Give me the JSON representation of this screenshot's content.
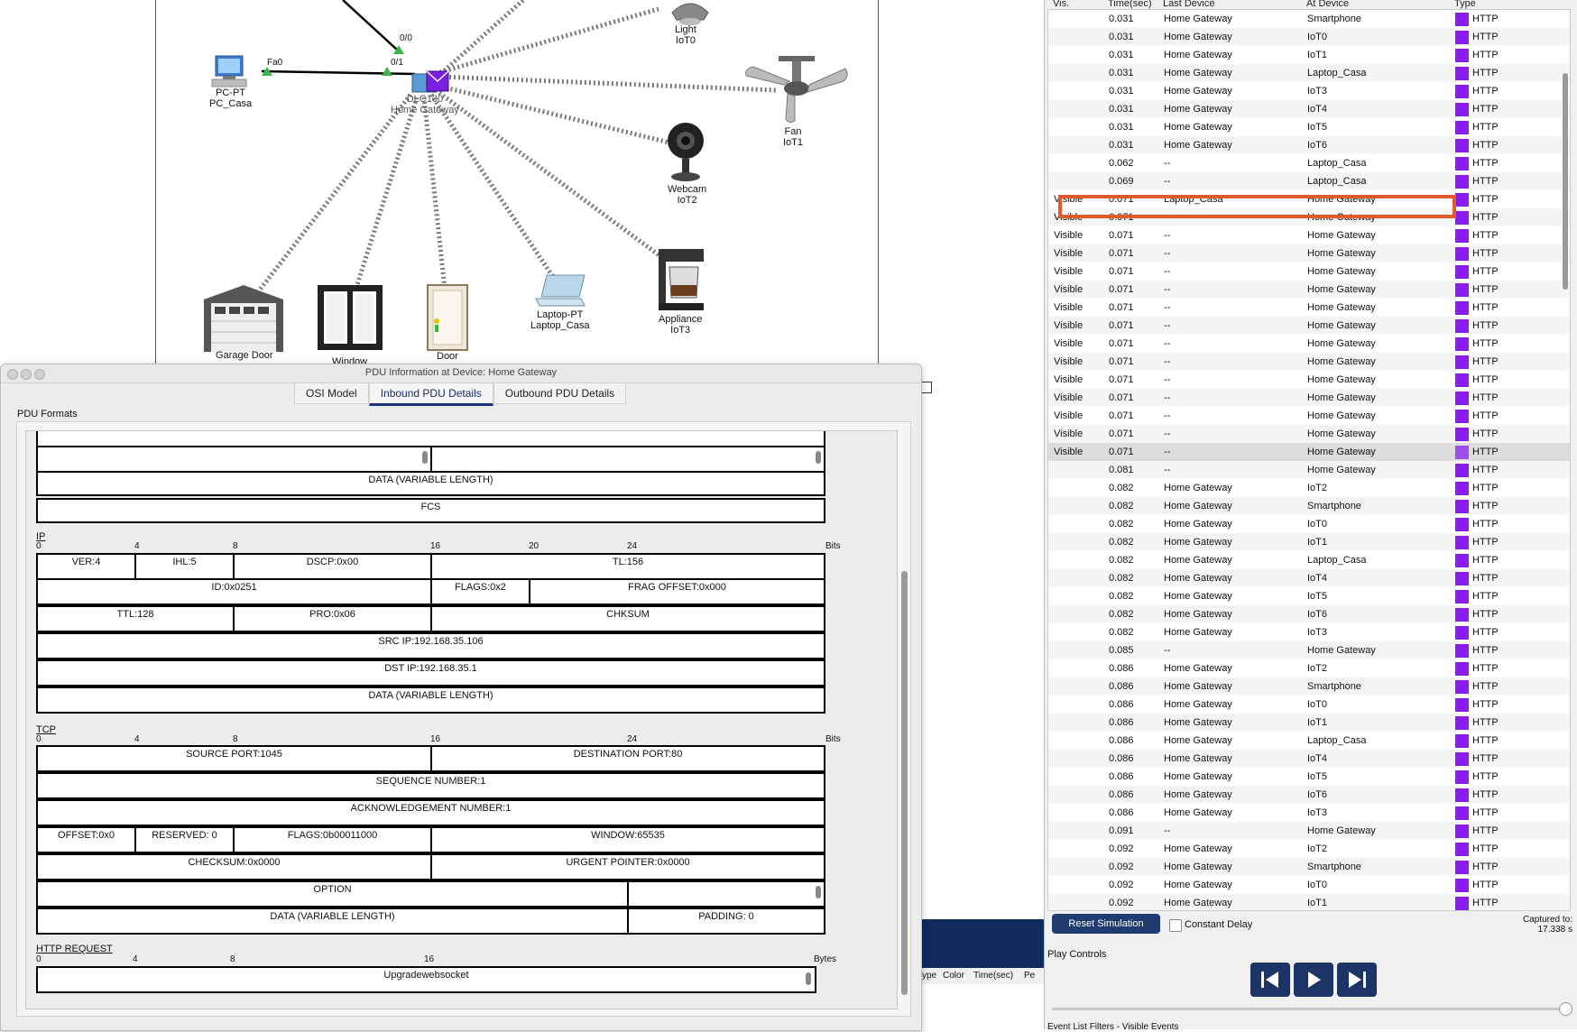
{
  "canvas": {
    "devices": {
      "pc": {
        "type": "PC-PT",
        "name": "PC_Casa"
      },
      "gateway": {
        "type": "DLC100",
        "name": "Home Gateway"
      },
      "light": {
        "type": "Light",
        "name": "IoT0"
      },
      "fan": {
        "type": "Fan",
        "name": "IoT1"
      },
      "webcam": {
        "type": "Webcam",
        "name": "IoT2"
      },
      "appliance": {
        "type": "Appliance",
        "name": "IoT3"
      },
      "laptop": {
        "type": "Laptop-PT",
        "name": "Laptop_Casa"
      },
      "door": {
        "name": "Door"
      },
      "window": {
        "name": "Window"
      },
      "garage": {
        "name": "Garage Door"
      }
    },
    "ports": {
      "fa0": "Fa0",
      "p00": "0/0",
      "p01": "0/1"
    }
  },
  "pdu_window": {
    "title": "PDU Information at Device: Home Gateway",
    "tabs": [
      "OSI Model",
      "Inbound PDU Details",
      "Outbound PDU Details"
    ],
    "active_tab": "Inbound PDU Details",
    "formats_label": "PDU Formats",
    "ethernet": {
      "data": "DATA (VARIABLE LENGTH)",
      "fcs": "FCS"
    },
    "ip": {
      "title": "IP",
      "ticks": [
        "0",
        "4",
        "8",
        "16",
        "20",
        "24",
        "Bits"
      ],
      "ver": "VER:4",
      "ihl": "IHL:5",
      "dscp": "DSCP:0x00",
      "tl": "TL:156",
      "id": "ID:0x0251",
      "flags": "FLAGS:0x2",
      "frag": "FRAG OFFSET:0x000",
      "ttl": "TTL:128",
      "pro": "PRO:0x06",
      "chksum": "CHKSUM",
      "src": "SRC IP:192.168.35.106",
      "dst": "DST IP:192.168.35.1",
      "data": "DATA (VARIABLE LENGTH)"
    },
    "tcp": {
      "title": "TCP",
      "ticks": [
        "0",
        "4",
        "8",
        "16",
        "24",
        "Bits"
      ],
      "src_port": "SOURCE PORT:1045",
      "dst_port": "DESTINATION PORT:80",
      "seq": "SEQUENCE NUMBER:1",
      "ack": "ACKNOWLEDGEMENT NUMBER:1",
      "offset": "OFFSET:0x0",
      "reserved": "RESERVED: 0",
      "flags": "FLAGS:0b00011000",
      "window": "WINDOW:65535",
      "checksum": "CHECKSUM:0x0000",
      "urgent": "URGENT POINTER:0x0000",
      "option": "OPTION",
      "data": "DATA (VARIABLE LENGTH)",
      "padding": "PADDING: 0"
    },
    "http": {
      "title": "HTTP REQUEST",
      "ticks": [
        "0",
        "4",
        "8",
        "16",
        "Bytes"
      ],
      "content": "Upgradewebsocket"
    }
  },
  "event_list": {
    "headers": [
      "Vis.",
      "Time(sec)",
      "Last Device",
      "At Device",
      "Type"
    ],
    "type_color": "#8a1cf0",
    "highlight_color": "#e05a2b",
    "rows": [
      [
        "",
        "0.031",
        "Home Gateway",
        "Smartphone",
        "HTTP"
      ],
      [
        "",
        "0.031",
        "Home Gateway",
        "IoT0",
        "HTTP"
      ],
      [
        "",
        "0.031",
        "Home Gateway",
        "IoT1",
        "HTTP"
      ],
      [
        "",
        "0.031",
        "Home Gateway",
        "Laptop_Casa",
        "HTTP"
      ],
      [
        "",
        "0.031",
        "Home Gateway",
        "IoT3",
        "HTTP"
      ],
      [
        "",
        "0.031",
        "Home Gateway",
        "IoT4",
        "HTTP"
      ],
      [
        "",
        "0.031",
        "Home Gateway",
        "IoT5",
        "HTTP"
      ],
      [
        "",
        "0.031",
        "Home Gateway",
        "IoT6",
        "HTTP"
      ],
      [
        "",
        "0.062",
        "--",
        "Laptop_Casa",
        "HTTP"
      ],
      [
        "",
        "0.069",
        "--",
        "Laptop_Casa",
        "HTTP"
      ],
      [
        "Visible",
        "0.071",
        "Laptop_Casa",
        "Home Gateway",
        "HTTP"
      ],
      [
        "Visible",
        "0.071",
        "--",
        "Home Gateway",
        "HTTP"
      ],
      [
        "Visible",
        "0.071",
        "--",
        "Home Gateway",
        "HTTP"
      ],
      [
        "Visible",
        "0.071",
        "--",
        "Home Gateway",
        "HTTP"
      ],
      [
        "Visible",
        "0.071",
        "--",
        "Home Gateway",
        "HTTP"
      ],
      [
        "Visible",
        "0.071",
        "--",
        "Home Gateway",
        "HTTP"
      ],
      [
        "Visible",
        "0.071",
        "--",
        "Home Gateway",
        "HTTP"
      ],
      [
        "Visible",
        "0.071",
        "--",
        "Home Gateway",
        "HTTP"
      ],
      [
        "Visible",
        "0.071",
        "--",
        "Home Gateway",
        "HTTP"
      ],
      [
        "Visible",
        "0.071",
        "--",
        "Home Gateway",
        "HTTP"
      ],
      [
        "Visible",
        "0.071",
        "--",
        "Home Gateway",
        "HTTP"
      ],
      [
        "Visible",
        "0.071",
        "--",
        "Home Gateway",
        "HTTP"
      ],
      [
        "Visible",
        "0.071",
        "--",
        "Home Gateway",
        "HTTP"
      ],
      [
        "Visible",
        "0.071",
        "--",
        "Home Gateway",
        "HTTP"
      ],
      [
        "Visible",
        "0.071",
        "--",
        "Home Gateway",
        "HTTP"
      ],
      [
        "",
        "0.081",
        "--",
        "Home Gateway",
        "HTTP"
      ],
      [
        "",
        "0.082",
        "Home Gateway",
        "IoT2",
        "HTTP"
      ],
      [
        "",
        "0.082",
        "Home Gateway",
        "Smartphone",
        "HTTP"
      ],
      [
        "",
        "0.082",
        "Home Gateway",
        "IoT0",
        "HTTP"
      ],
      [
        "",
        "0.082",
        "Home Gateway",
        "IoT1",
        "HTTP"
      ],
      [
        "",
        "0.082",
        "Home Gateway",
        "Laptop_Casa",
        "HTTP"
      ],
      [
        "",
        "0.082",
        "Home Gateway",
        "IoT4",
        "HTTP"
      ],
      [
        "",
        "0.082",
        "Home Gateway",
        "IoT5",
        "HTTP"
      ],
      [
        "",
        "0.082",
        "Home Gateway",
        "IoT6",
        "HTTP"
      ],
      [
        "",
        "0.082",
        "Home Gateway",
        "IoT3",
        "HTTP"
      ],
      [
        "",
        "0.085",
        "--",
        "Home Gateway",
        "HTTP"
      ],
      [
        "",
        "0.086",
        "Home Gateway",
        "IoT2",
        "HTTP"
      ],
      [
        "",
        "0.086",
        "Home Gateway",
        "Smartphone",
        "HTTP"
      ],
      [
        "",
        "0.086",
        "Home Gateway",
        "IoT0",
        "HTTP"
      ],
      [
        "",
        "0.086",
        "Home Gateway",
        "IoT1",
        "HTTP"
      ],
      [
        "",
        "0.086",
        "Home Gateway",
        "Laptop_Casa",
        "HTTP"
      ],
      [
        "",
        "0.086",
        "Home Gateway",
        "IoT4",
        "HTTP"
      ],
      [
        "",
        "0.086",
        "Home Gateway",
        "IoT5",
        "HTTP"
      ],
      [
        "",
        "0.086",
        "Home Gateway",
        "IoT6",
        "HTTP"
      ],
      [
        "",
        "0.086",
        "Home Gateway",
        "IoT3",
        "HTTP"
      ],
      [
        "",
        "0.091",
        "--",
        "Home Gateway",
        "HTTP"
      ],
      [
        "",
        "0.092",
        "Home Gateway",
        "IoT2",
        "HTTP"
      ],
      [
        "",
        "0.092",
        "Home Gateway",
        "Smartphone",
        "HTTP"
      ],
      [
        "",
        "0.092",
        "Home Gateway",
        "IoT0",
        "HTTP"
      ],
      [
        "",
        "0.092",
        "Home Gateway",
        "IoT1",
        "HTTP"
      ]
    ],
    "reset_label": "Reset Simulation",
    "constant_delay_label": "Constant Delay",
    "captured_label": "Captured to:",
    "captured_value": "17.338 s",
    "play_controls_label": "Play Controls",
    "filter_label": "Event List Filters - Visible Events"
  },
  "bottom_headers": [
    "ype",
    "Color",
    "Time(sec)",
    "Pe"
  ]
}
